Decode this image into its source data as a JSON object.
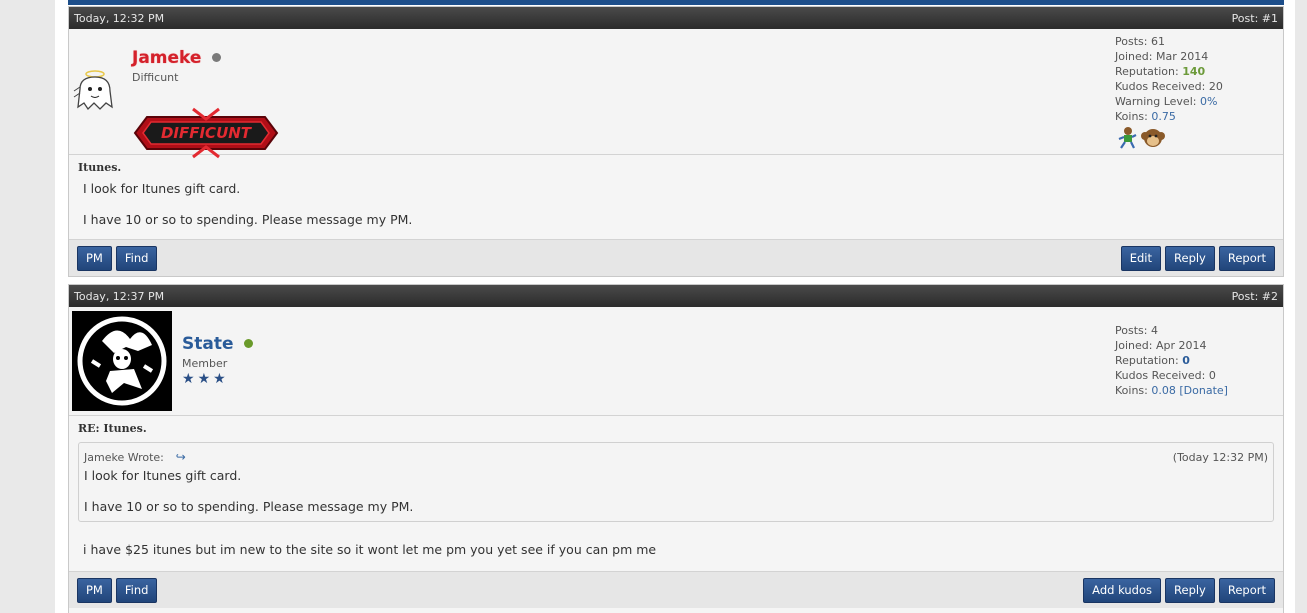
{
  "posts": [
    {
      "date": "Today, 12:32 PM",
      "post_no": "Post: #1",
      "username": "Jameke",
      "username_color": "#d4212b",
      "status_color": "#7a7a7a",
      "usertitle": "Difficunt",
      "banner_text": "DIFFICUNT",
      "stats": {
        "posts_label": "Posts:",
        "posts": "61",
        "joined_label": "Joined:",
        "joined": "Mar 2014",
        "rep_label": "Reputation:",
        "rep": "140",
        "kudos_label": "Kudos Received:",
        "kudos": "20",
        "warn_label": "Warning Level:",
        "warn": "0%",
        "koins_label": "Koins:",
        "koins": "0.75"
      },
      "subject": "Itunes.",
      "lines": [
        "I look for Itunes gift card.",
        "I have 10 or so to spending. Please message my PM."
      ],
      "left_buttons": [
        "PM",
        "Find"
      ],
      "right_buttons": [
        "Edit",
        "Reply",
        "Report"
      ]
    },
    {
      "date": "Today, 12:37 PM",
      "post_no": "Post: #2",
      "username": "State",
      "username_color": "#2a5b99",
      "status_color": "#6a9a2a",
      "usertitle": "Member",
      "stats": {
        "posts_label": "Posts:",
        "posts": "4",
        "joined_label": "Joined:",
        "joined": "Apr 2014",
        "rep_label": "Reputation:",
        "rep": "0",
        "kudos_label": "Kudos Received:",
        "kudos": "0",
        "koins_label": "Koins:",
        "koins": "0.08",
        "donate": "[Donate]"
      },
      "subject": "RE: Itunes.",
      "quote": {
        "author": "Jameke Wrote:",
        "time": "(Today 12:32 PM)",
        "lines": [
          "I look for Itunes gift card.",
          "I have 10 or so to spending. Please message my PM."
        ]
      },
      "message": "i have $25 itunes but im new to the site so it wont let me pm you yet see if you can pm me",
      "left_buttons": [
        "PM",
        "Find"
      ],
      "right_buttons": [
        "Add kudos",
        "Reply",
        "Report"
      ]
    }
  ]
}
